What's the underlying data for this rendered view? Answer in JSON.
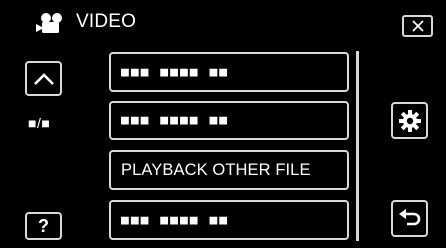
{
  "header": {
    "title": "VIDEO",
    "icon": "video-camera-icon"
  },
  "left_panel": {
    "page_indicator": "■/■",
    "help_label": "?"
  },
  "menu_items": [
    {
      "label": "■■■ ■■■■ ■■",
      "state": "unreadable"
    },
    {
      "label": "■■■ ■■■■ ■■",
      "state": "unreadable"
    },
    {
      "label": "PLAYBACK OTHER FILE",
      "state": "readable"
    },
    {
      "label": "■■■ ■■■■ ■■",
      "state": "unreadable"
    }
  ],
  "icons": {
    "close": "close-icon",
    "up": "chevron-up-icon",
    "settings": "gear-icon",
    "back": "return-arrow-icon"
  },
  "colors": {
    "background": "#000000",
    "border": "#d8d8d8",
    "text": "#ffffff"
  }
}
